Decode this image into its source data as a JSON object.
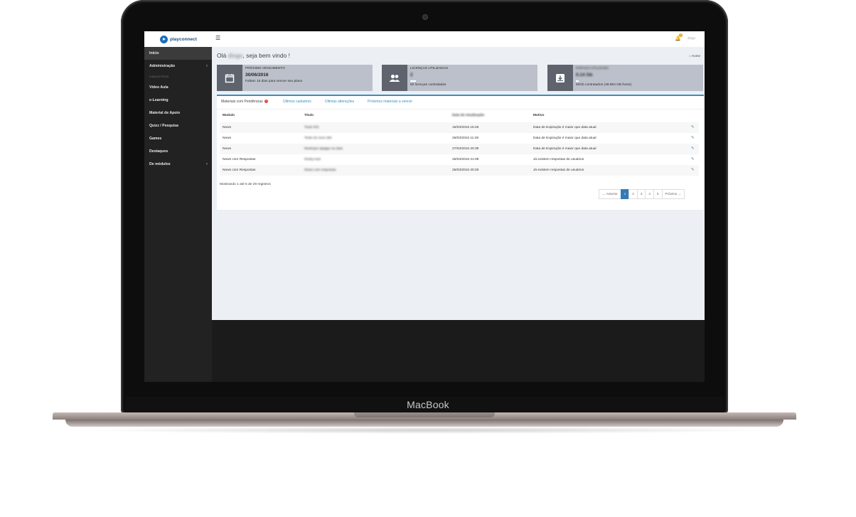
{
  "device": {
    "brand_label": "MacBook"
  },
  "topbar": {
    "logo_text": "playconnect",
    "menu_icon": "hamburger-icon",
    "notification_icon": "bell-icon",
    "notification_count": "1",
    "user_name": "diogo"
  },
  "sidebar": {
    "items": [
      {
        "label": "Início",
        "active": true
      },
      {
        "label": "Administração",
        "caret": "‹"
      },
      {
        "section": "CADASTROS"
      },
      {
        "label": "Vídeo Aula"
      },
      {
        "label": "e-Learning"
      },
      {
        "label": "Material de Apoio"
      },
      {
        "label": "Quizz / Pesquisa"
      },
      {
        "label": "Games"
      },
      {
        "label": "Destaques"
      },
      {
        "label": "De módulos",
        "caret": "‹"
      }
    ]
  },
  "header": {
    "greeting_prefix": "Olá",
    "greeting_name": "diogo",
    "greeting_suffix": ", seja bem vindo !",
    "breadcrumb_icon": "home-icon",
    "breadcrumb": "Home"
  },
  "cards": [
    {
      "icon": "calendar-icon",
      "label": "PRÓXIMO VENCIMENTO",
      "value": "30/06/2016",
      "desc": "Faltam 16 dias para vencer seu plano"
    },
    {
      "icon": "users-icon",
      "label": "LICENÇAS UTILIZADAS",
      "value": "2",
      "desc": "50 licenças contratadas"
    },
    {
      "icon": "storage-icon",
      "label": "ESPAÇO UTILIZADO",
      "value": "0.14 Gb",
      "desc": "50Gb contratados (49.853 GB livres)"
    }
  ],
  "tabs": [
    {
      "label": "Materiais com Pendências",
      "badge": "!"
    },
    {
      "label": "Últimos cadastros"
    },
    {
      "label": "Últimas alterações"
    },
    {
      "label": "Próximos materiais a vencer"
    }
  ],
  "table": {
    "columns": [
      "Modulo",
      "Título",
      "Data de Atualização",
      "Motivo"
    ],
    "rows": [
      {
        "modulo": "News",
        "titulo": "Teste 001",
        "data": "15/03/2016 15:46",
        "motivo": "Data de Expiração é maior que data atual"
      },
      {
        "modulo": "News",
        "titulo": "Teste do novo site",
        "data": "26/03/2016 11:48",
        "motivo": "Data de Expiração é maior que data atual"
      },
      {
        "modulo": "News",
        "titulo": "Mostrque sjaiggu na data",
        "data": "27/03/2016 20:39",
        "motivo": "Data de Expiração é maior que data atual"
      },
      {
        "modulo": "News com Respostas",
        "titulo": "Destq man",
        "data": "25/03/2016 21:08",
        "motivo": "Já existem respostas de usuários"
      },
      {
        "modulo": "News com Respostas",
        "titulo": "News com respostas",
        "data": "25/03/2016 20:29",
        "motivo": "Já existem respostas de usuários"
      }
    ],
    "summary": "Mostrando 1 até 5 de 29 registros"
  },
  "pagination": {
    "prev": "← Anterior",
    "pages": [
      "1",
      "2",
      "3",
      "4",
      "5"
    ],
    "current": "1",
    "next": "Próximo →"
  },
  "colors": {
    "accent": "#3c8dbc",
    "sidebar_bg": "#222222",
    "card_bg": "#bcc0ca",
    "card_icon_bg": "#5e636d"
  }
}
